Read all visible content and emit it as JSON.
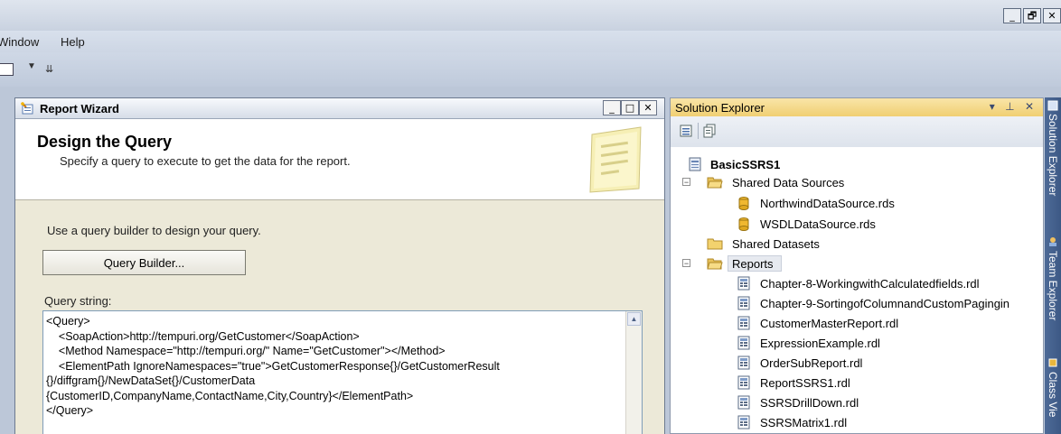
{
  "window": {
    "buttons": [
      "_",
      "🗗",
      "✕"
    ]
  },
  "menu": {
    "items": [
      "Window",
      "Help"
    ]
  },
  "wizard": {
    "title": "Report Wizard",
    "buttons": [
      "_",
      "□",
      "✕"
    ],
    "heading": "Design the Query",
    "subheading": "Specify a query to execute to get the data for the report.",
    "instruction": "Use a query builder to design your query.",
    "query_builder_label": "Query Builder...",
    "query_string_label": "Query string:",
    "query_string": "<Query>\n    <SoapAction>http://tempuri.org/GetCustomer</SoapAction>\n    <Method Namespace=\"http://tempuri.org/\" Name=\"GetCustomer\"></Method>\n    <ElementPath IgnoreNamespaces=\"true\">GetCustomerResponse{}/GetCustomerResult\n{}/diffgram{}/NewDataSet{}/CustomerData\n{CustomerID,CompanyName,ContactName,City,Country}</ElementPath>\n</Query>"
  },
  "solution_explorer": {
    "title": "Solution Explorer",
    "title_buttons": "▾ ⊥ ✕",
    "project": "BasicSSRS1",
    "shared_data_sources_label": "Shared Data Sources",
    "data_sources": [
      "NorthwindDataSource.rds",
      "WSDLDataSource.rds"
    ],
    "shared_datasets_label": "Shared Datasets",
    "reports_label": "Reports",
    "reports": [
      "Chapter-8-WorkingwithCalculatedfields.rdl",
      "Chapter-9-SortingofColumnandCustomPagingin",
      "CustomerMasterReport.rdl",
      "ExpressionExample.rdl",
      "OrderSubReport.rdl",
      "ReportSSRS1.rdl",
      "SSRSDrillDown.rdl",
      "SSRSMatrix1.rdl"
    ]
  },
  "side_tabs": [
    "Solution Explorer",
    "Team Explorer",
    "Class Vie"
  ]
}
